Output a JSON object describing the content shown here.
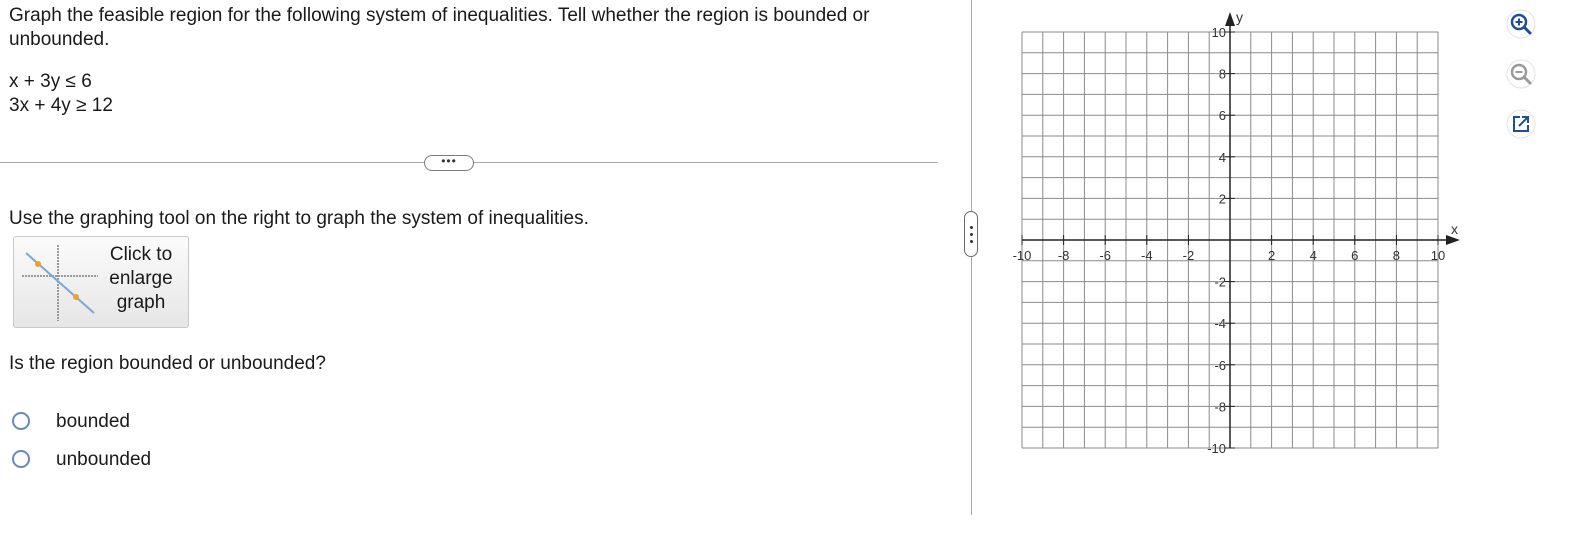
{
  "question": {
    "prompt": "Graph the feasible region for the following system of inequalities. Tell whether the region is bounded or unbounded.",
    "inequalities": [
      "x + 3y ≤ 6",
      "3x + 4y ≥ 12"
    ],
    "expand_label": "•••",
    "instruction": "Use the graphing tool on the right to graph the system of inequalities.",
    "enlarge_button_label": "Click to\nenlarge\ngraph",
    "sub_question": "Is the region bounded or unbounded?",
    "options": [
      "bounded",
      "unbounded"
    ]
  },
  "graph": {
    "x_axis_label": "x",
    "y_axis_label": "y",
    "x_range": [
      -10,
      10
    ],
    "y_range": [
      -10,
      10
    ],
    "grid_step": 1,
    "x_tick_labels": [
      "-10",
      "-8",
      "-6",
      "-4",
      "-2",
      "2",
      "4",
      "6",
      "8",
      "10"
    ],
    "y_tick_labels": [
      "10",
      "8",
      "6",
      "4",
      "2",
      "-2",
      "-4",
      "-6",
      "-8",
      "-10"
    ],
    "grid": true
  },
  "toolbar": {
    "zoom_in_icon": "zoom-in-icon",
    "zoom_out_icon": "zoom-out-icon",
    "popout_icon": "popout-icon"
  },
  "colors": {
    "radio_border": "#6a86c5",
    "thumb_line": "#7aa6d6",
    "thumb_point": "#f0a030",
    "toolbar_icon": "#1f4e96"
  }
}
